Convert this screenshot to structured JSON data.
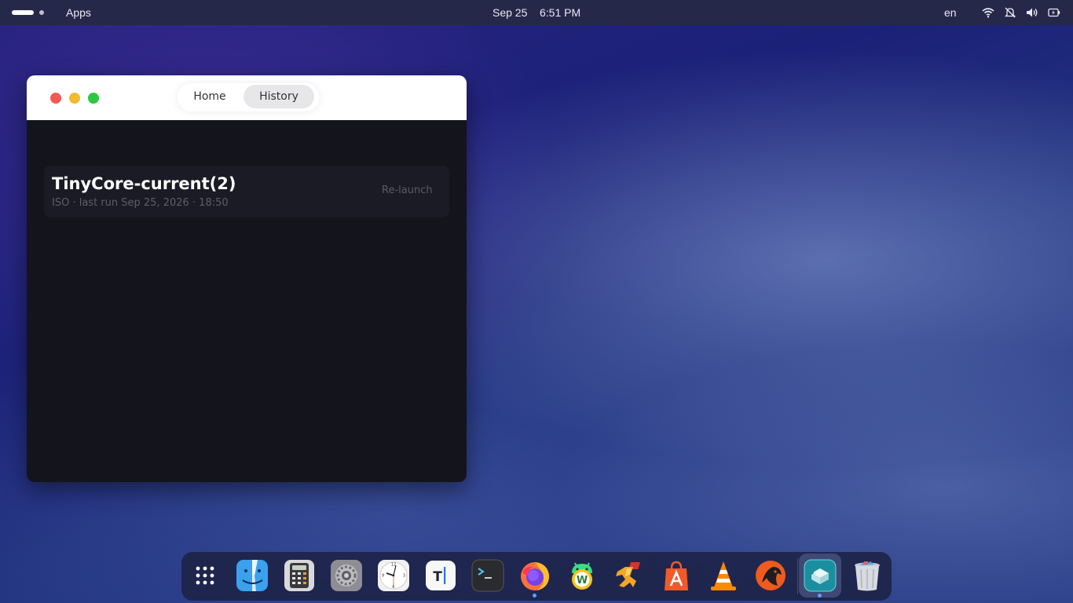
{
  "topbar": {
    "apps_label": "Apps",
    "date": "Sep 25",
    "time": "6:51 PM",
    "language": "en",
    "icons": [
      "wifi-icon",
      "notifications-off-icon",
      "volume-icon",
      "battery-icon"
    ]
  },
  "window": {
    "tabs": [
      {
        "label": "Home",
        "active": false
      },
      {
        "label": "History",
        "active": true
      }
    ],
    "history": [
      {
        "name": "TinyCore-current(2)",
        "details": "ISO · last run Sep 25, 2026 · 18:50",
        "action": "Re-launch"
      }
    ]
  },
  "dock": {
    "items": [
      {
        "name": "app-grid-icon"
      },
      {
        "name": "finder-icon"
      },
      {
        "name": "calculator-icon"
      },
      {
        "name": "settings-icon"
      },
      {
        "name": "clock-icon"
      },
      {
        "name": "text-editor-icon"
      },
      {
        "name": "terminal-icon"
      },
      {
        "name": "firefox-icon",
        "running": true
      },
      {
        "name": "android-wine-icon"
      },
      {
        "name": "runner-app-icon"
      },
      {
        "name": "app-store-icon"
      },
      {
        "name": "vlc-icon"
      },
      {
        "name": "fox-app-icon"
      },
      {
        "name": "vm-launcher-icon",
        "running": true,
        "active": true
      },
      {
        "name": "trash-icon"
      }
    ]
  },
  "colors": {
    "titlebar": "#ffffff",
    "window_bg": "#14141d",
    "card_bg": "#1b1b25",
    "close": "#f05a52",
    "minimize": "#f3bb2d",
    "maximize": "#2cc840"
  }
}
